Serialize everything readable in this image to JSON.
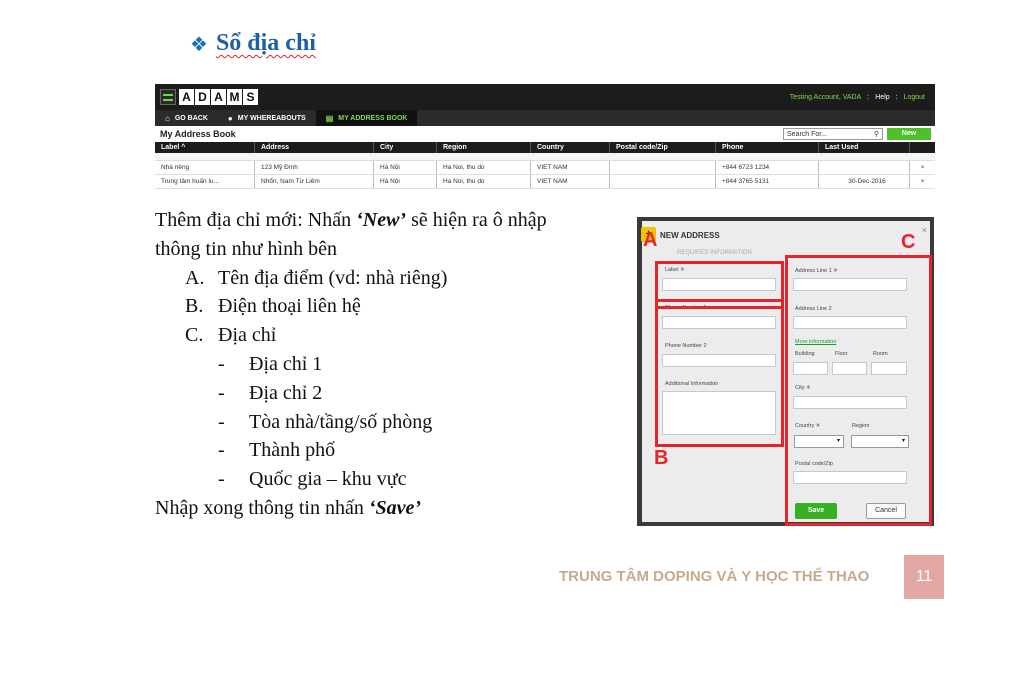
{
  "slide": {
    "title_bullet": "❖",
    "title": "Sổ địa chỉ"
  },
  "adams": {
    "logo_letters": [
      "A",
      "D",
      "A",
      "M",
      "S"
    ],
    "account": "Testing Account, VADA",
    "separator": ":",
    "help": "Help",
    "logout": "Logout",
    "nav": [
      {
        "label": "GO BACK",
        "icon": "home-icon"
      },
      {
        "label": "MY WHEREABOUTS",
        "icon": "location-pin-icon"
      },
      {
        "label": "MY ADDRESS BOOK",
        "icon": "address-book-icon"
      }
    ],
    "page_heading": "My Address Book",
    "search_placeholder": "Search For...",
    "new_button": "New",
    "columns": [
      "Label ^",
      "Address",
      "City",
      "Region",
      "Country",
      "Postal code/Zip",
      "Phone",
      "Last Used",
      ""
    ],
    "rows": [
      [
        "Nhà riêng",
        "123 Mỹ Đình",
        "Hà Nội",
        "Ha Noi, thu do",
        "VIET NAM",
        "",
        "+844 6723 1234",
        "",
        "×"
      ],
      [
        "Trung tâm huấn lu...",
        "Nhổn, Nam Từ Liêm",
        "Hà Nội",
        "Ha Noi, thu do",
        "VIET NAM",
        "",
        "+844 3765 5131",
        "30-Dec-2016",
        "×"
      ]
    ]
  },
  "instructions": {
    "line1_pre": "Thêm địa chỉ mới: Nhấn ",
    "line1_em": "‘New’",
    "line1_post": " sẽ hiện ra ô nhập",
    "line2": "thông tin như hình bên",
    "items": [
      {
        "marker": "A.",
        "text": "Tên địa điểm (vd: nhà riêng)"
      },
      {
        "marker": "B.",
        "text": "Điện thoại liên hệ"
      },
      {
        "marker": "C.",
        "text": "Địa chỉ"
      }
    ],
    "subitems": [
      {
        "marker": "-",
        "text": "Địa chỉ 1"
      },
      {
        "marker": "-",
        "text": "Địa chỉ 2"
      },
      {
        "marker": "-",
        "text": "Tòa nhà/tầng/số phòng"
      },
      {
        "marker": "-",
        "text": "Thành phố"
      },
      {
        "marker": "-",
        "text": "Quốc gia – khu vực"
      }
    ],
    "last_pre": "Nhập xong thông tin nhấn ",
    "last_em": "‘Save’"
  },
  "dialog": {
    "title": "NEW ADDRESS",
    "subtitle": "REQUIRED INFORMATION",
    "close": "×",
    "add_icon": "+",
    "label_field": "Label ✳",
    "phone1": "Phone Number 1",
    "phone2": "Phone Number 2",
    "additional": "Additional Information",
    "address1": "Address Line 1 ✳",
    "address2": "Address Line 2",
    "more_info": "More information",
    "building": "Building",
    "floor": "Floor",
    "room": "Room",
    "city": "City ✳",
    "country": "Country ✳",
    "region": "Region",
    "postal": "Postal code/Zip",
    "save": "Save",
    "cancel": "Cancel",
    "select_arrow": "▾",
    "markers": {
      "a": "A",
      "b": "B",
      "c": "C"
    }
  },
  "footer": {
    "text": "TRUNG TÂM DOPING VÀ Y HỌC THỂ THAO",
    "page": "11"
  }
}
